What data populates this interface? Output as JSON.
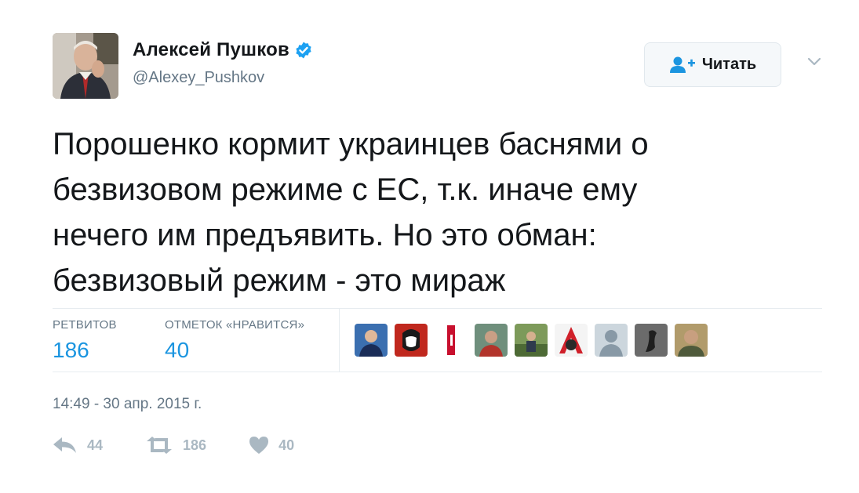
{
  "author": {
    "display_name": "Алексей Пушков",
    "handle": "@Alexey_Pushkov",
    "verified_icon": "verified-badge-icon"
  },
  "follow_button": {
    "label": "Читать",
    "icon": "follow-user-icon"
  },
  "tweet": {
    "text": "Порошенко кормит украинцев баснями о\nбезвизовом режиме с ЕС, т.к. иначе ему\nнечего им предъявить. Но это обман:\nбезвизовый режим - это мираж"
  },
  "stats": {
    "retweets_label": "РЕТВИТОВ",
    "retweets_value": "186",
    "likes_label": "ОТМЕТОК «НРАВИТСЯ»",
    "likes_value": "40"
  },
  "timestamp": "14:49 - 30 апр. 2015 г.",
  "actions": {
    "reply_count": "44",
    "retweet_count": "186",
    "like_count": "40"
  },
  "colors": {
    "accent": "#1b95e0",
    "verified": "#1da1f2",
    "muted": "#657786",
    "action_gray": "#aab8c2"
  }
}
